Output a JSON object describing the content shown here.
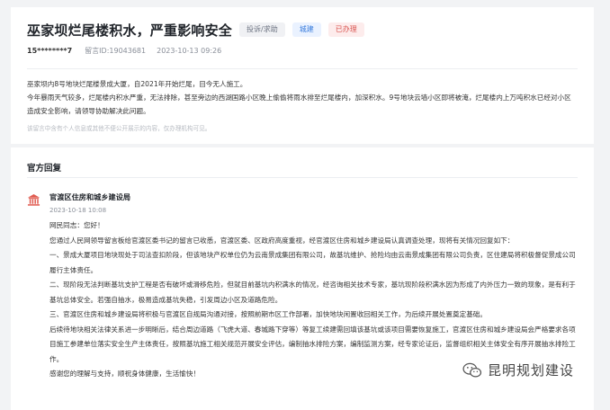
{
  "post": {
    "title": "巫家坝烂尾楼积水，严重影响安全",
    "tags": [
      {
        "label": "投诉/求助",
        "color": "#6b7280"
      },
      {
        "label": "城建",
        "color": "#3b7ddd"
      },
      {
        "label": "已办理",
        "color": "#d9534f"
      }
    ],
    "user": "15********7",
    "message_id": "留言ID:19043681",
    "datetime": "2023-10-13 09:26",
    "content": [
      "巫家坝内8号地块烂尾楼景成大厦，自2021年开始烂尾，目今无人施工。",
      "今年暴雨天气较多，烂尾楼内积水严重，无法排除，甚至旁边的西湖国路小区晚上偷偷将雨水排至烂尾楼内，加深积水。9号地块云墙小区即将被淹，烂尾楼内上万吨积水已经对小区造成安全影响，请领导协助解决此问题。"
    ],
    "note": "该留言中含有个人信息或其他不便公开展示的内容，仅办理机构可见。"
  },
  "reply": {
    "section_title": "官方回复",
    "department": "官渡区住房和城乡建设局",
    "date": "2023-10-18 10:08",
    "paragraphs": [
      "网民同志：您好！",
      "您通过人民网领导留言板给官渡区委书记的留言已收悉，官渡区委、区政府高度重视，经官渡区住房和城乡建设局认真调查处理，现将有关情况回复如下：",
      "一、景成大厦项目地块现处于司法查扣阶段，但该地块产权单位仍为云南景成集团有限公司，故基坑维护、抢险均由云南景成集团有限公司负责，区住建局将积极督促景成公司履行主体责任。",
      "二、现阶段无法判断基坑支护工程是否有破坏或滑移危险，但就目前基坑内积满水的情况，经咨询相关技术专家，基坑现阶段积满水因为形成了内外压力一致的现象，是有利于基坑总体安全。若强自抽水，极易造成基坑失稳，引发周边小区及道路危险。",
      "三、官渡区住房和城乡建设局将积极与官渡区自规局沟通对接，按照前期市区工作部署，加快地块闲置收回相关工作，为后续开展处置奠定基础。",
      "后续待地块相关法律关系进一步明晰后，结合周边道路（飞虎大道、春城路下穿等）等复工续建需回填该基坑或该项目需要恢复施工，官渡区住房和城乡建设局会严格要求各项目施工参建单位落实安全生产主体责任，按照基坑施工相关规范开展安全评估，编制抽水排险方案，编制监测方案，经专家论证后，监督组织相关主体安全有序开展抽水排险工作。",
      "感谢您的理解与支持，顺祝身体健康，生活愉快！"
    ]
  },
  "watermark": {
    "text": "昆明规划建设"
  }
}
